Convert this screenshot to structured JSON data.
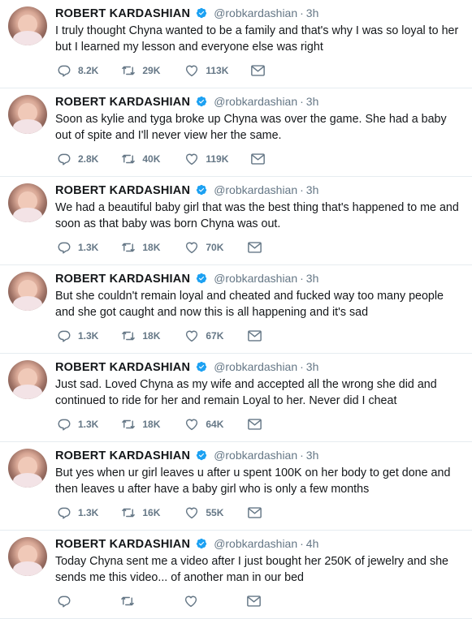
{
  "tweets": [
    {
      "name": "ROBERT KARDASHIAN",
      "handle": "@robkardashian",
      "time": "3h",
      "text": "I truly thought Chyna wanted to be a family and that's why I was so loyal to her but I learned my lesson and everyone else was right",
      "replies": "8.2K",
      "retweets": "29K",
      "likes": "113K"
    },
    {
      "name": "ROBERT KARDASHIAN",
      "handle": "@robkardashian",
      "time": "3h",
      "text": "Soon as kylie and tyga broke up Chyna was over the game. She had a baby out of spite and I'll never view her the same.",
      "replies": "2.8K",
      "retweets": "40K",
      "likes": "119K"
    },
    {
      "name": "ROBERT KARDASHIAN",
      "handle": "@robkardashian",
      "time": "3h",
      "text": "We had a beautiful baby girl that was the best thing that's happened to me and soon as that baby was born Chyna was out.",
      "replies": "1.3K",
      "retweets": "18K",
      "likes": "70K"
    },
    {
      "name": "ROBERT KARDASHIAN",
      "handle": "@robkardashian",
      "time": "3h",
      "text": "But she couldn't remain loyal and cheated and fucked way too many people and she got caught and now this is all happening and it's sad",
      "replies": "1.3K",
      "retweets": "18K",
      "likes": "67K"
    },
    {
      "name": "ROBERT KARDASHIAN",
      "handle": "@robkardashian",
      "time": "3h",
      "text": "Just sad. Loved Chyna as my wife and accepted all the wrong she did and continued to ride for her and remain Loyal to her. Never did I cheat",
      "replies": "1.3K",
      "retweets": "18K",
      "likes": "64K"
    },
    {
      "name": "ROBERT KARDASHIAN",
      "handle": "@robkardashian",
      "time": "3h",
      "text": "But yes when ur girl leaves u after u spent 100K on her body to get done and then leaves u after have a baby girl who is only a few months",
      "replies": "1.3K",
      "retweets": "16K",
      "likes": "55K"
    },
    {
      "name": "ROBERT KARDASHIAN",
      "handle": "@robkardashian",
      "time": "4h",
      "text": "Today Chyna sent me a video after I just bought her 250K of jewelry and she sends me this video... of another man in our bed",
      "replies": "",
      "retweets": "",
      "likes": ""
    }
  ],
  "icons": {
    "verified": "verified-badge-icon",
    "reply": "reply-icon",
    "retweet": "retweet-icon",
    "like": "heart-icon",
    "dm": "envelope-icon"
  },
  "colors": {
    "verified": "#1da1f2",
    "secondary_text": "#657786",
    "divider": "#e6ecf0"
  }
}
